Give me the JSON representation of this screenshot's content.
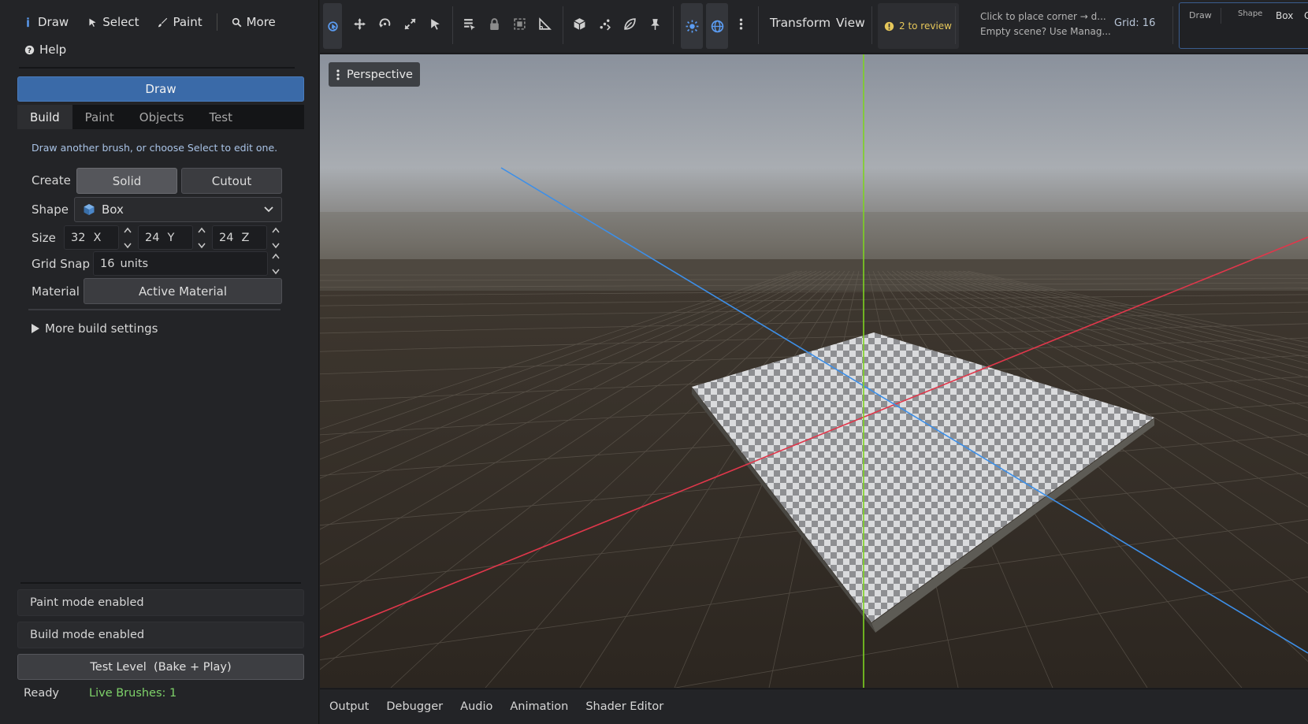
{
  "mode_bar": {
    "draw": "Draw",
    "select": "Select",
    "paint": "Paint",
    "more": "More",
    "help": "Help"
  },
  "draw_banner": "Draw",
  "tabs": [
    "Build",
    "Paint",
    "Objects",
    "Test"
  ],
  "hint": "Draw another brush, or choose Select to edit one.",
  "create": {
    "label": "Create",
    "solid": "Solid",
    "cutout": "Cutout"
  },
  "shape": {
    "label": "Shape",
    "value": "Box"
  },
  "size": {
    "label": "Size",
    "x": "32",
    "x_axis": "X",
    "y": "24",
    "y_axis": "Y",
    "z": "24",
    "z_axis": "Z"
  },
  "grid_snap": {
    "label": "Grid Snap",
    "value": "16",
    "unit": "units"
  },
  "material": {
    "label": "Material",
    "value": "Active Material"
  },
  "more_build_settings": "More build settings",
  "status_messages": [
    "Paint mode enabled",
    "Build mode enabled"
  ],
  "test_level_button": "Test Level  (Bake + Play)",
  "footer": {
    "ready": "Ready",
    "live_brushes": "Live Brushes: 1"
  },
  "toolbar": {
    "transform": "Transform",
    "view": "View",
    "review": "2 to review",
    "tip1": "Click to place corner → d...",
    "tip2": "Empty scene? Use Manag...",
    "grid": "Grid: 16",
    "mini_panel": {
      "draw": "Draw",
      "shape": "Shape",
      "box": "Box",
      "cut": "C"
    }
  },
  "viewport": {
    "view_mode": "Perspective"
  },
  "bottom_tabs": [
    "Output",
    "Debugger",
    "Audio",
    "Animation",
    "Shader Editor"
  ],
  "colors": {
    "accent": "#3a6aa8",
    "live": "#7fd36a",
    "axis_x": "#e0374b",
    "axis_y": "#7dd321",
    "axis_z": "#3d8fe8"
  }
}
